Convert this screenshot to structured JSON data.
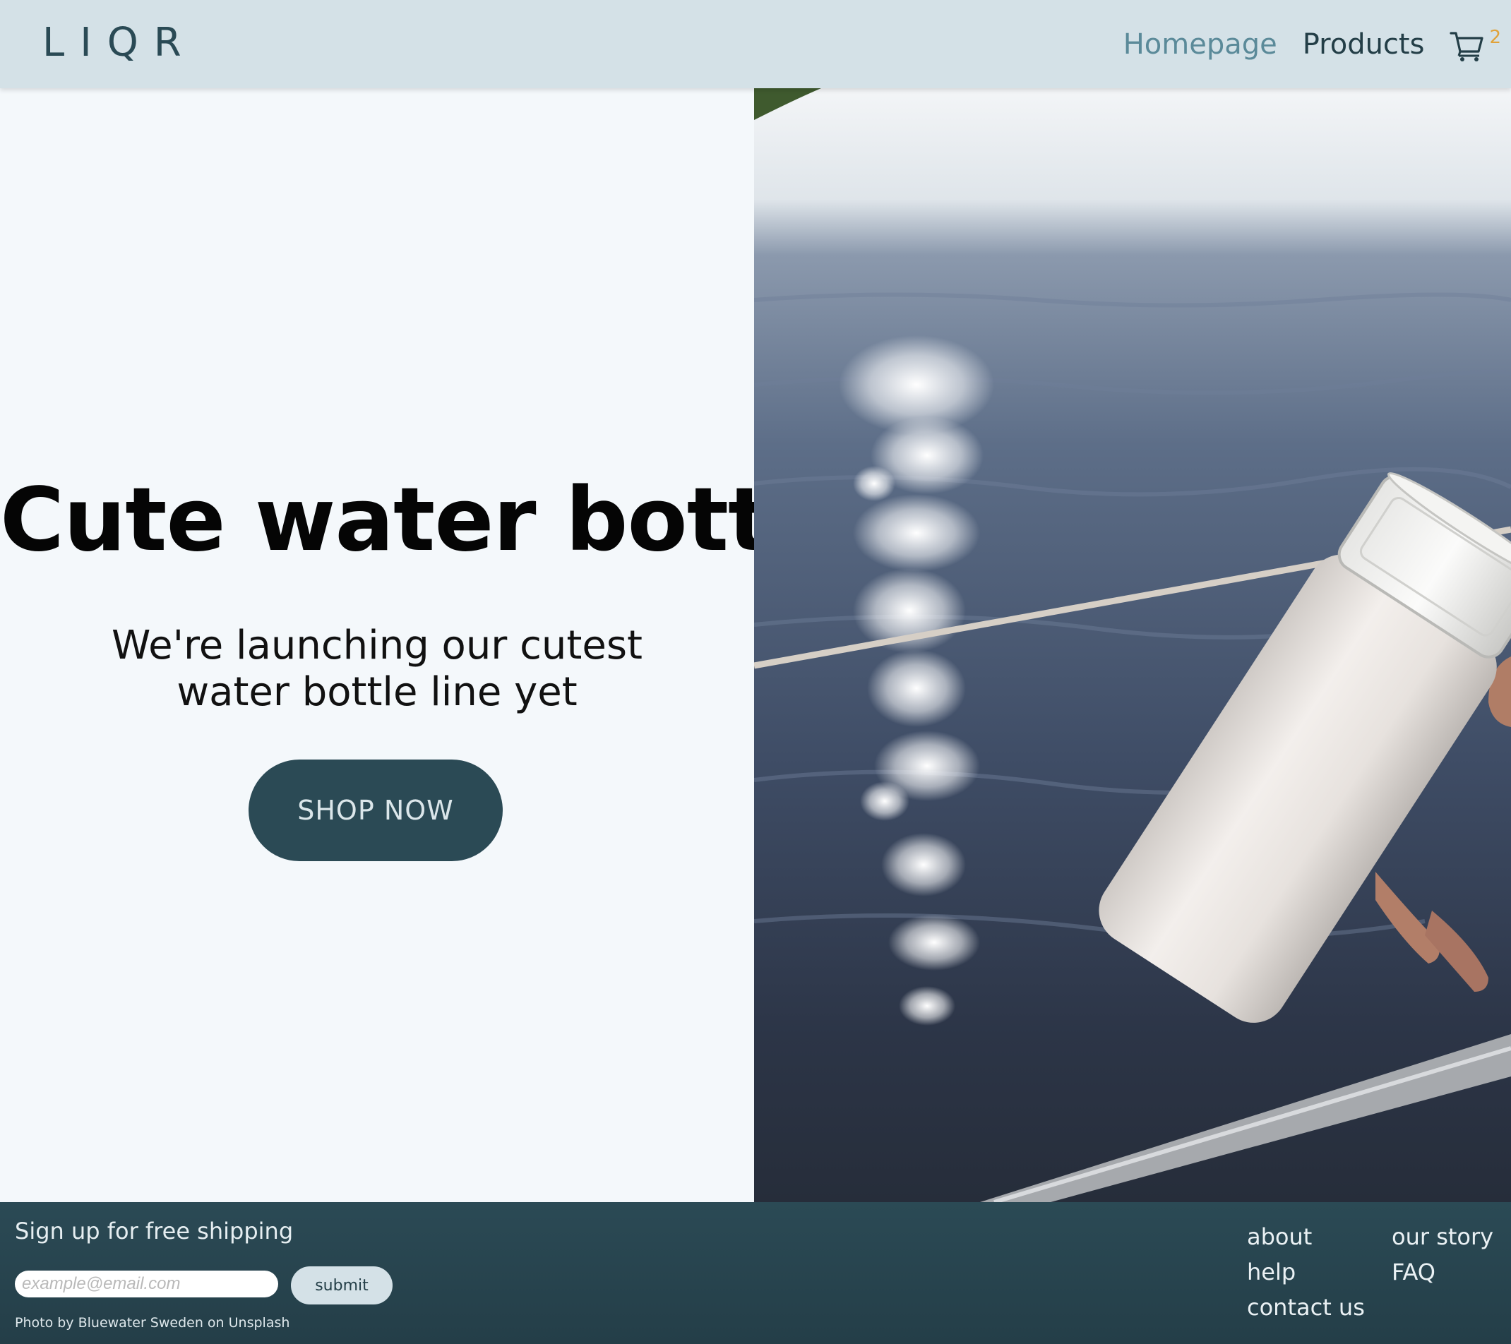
{
  "header": {
    "logo": "LIQR",
    "nav": {
      "home": "Homepage",
      "products": "Products"
    },
    "cart": {
      "icon": "shopping-cart-icon",
      "count": "2"
    }
  },
  "hero": {
    "title": "Cute water bottle",
    "subtitle_line1": "We're launching our cutest",
    "subtitle_line2": "water bottle line yet",
    "cta": "SHOP NOW",
    "image_alt": "Hand holding a white water bottle over sunlit sea"
  },
  "footer": {
    "signup_label": "Sign up for free shipping",
    "email_placeholder": "example@email.com",
    "submit_label": "submit",
    "credit": "Photo by Bluewater Sweden on Unsplash",
    "links": {
      "about": "about",
      "help": "help",
      "contact": "contact us",
      "story": "our story",
      "faq": "FAQ"
    }
  },
  "colors": {
    "header_bg": "#d4e1e7",
    "primary_dark": "#2b4a55",
    "nav_active": "#5b8a99",
    "cart_badge": "#e0a23a",
    "page_bg": "#f4f8fb"
  }
}
